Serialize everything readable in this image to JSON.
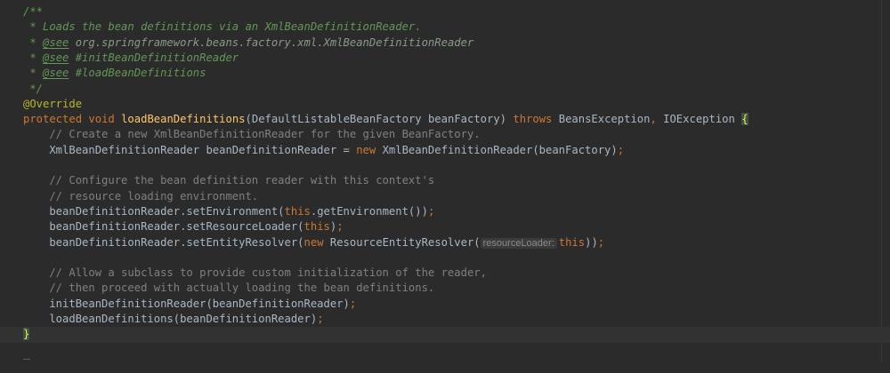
{
  "editor": {
    "lines": {
      "l1": {
        "t1": "/**"
      },
      "l2": {
        "t1": " * Loads the bean definitions via an XmlBeanDefinitionReader."
      },
      "l3": {
        "t1": " * ",
        "t2": "@see",
        "t3": " org.springframework.beans.factory.xml.XmlBeanDefinitionReader"
      },
      "l4": {
        "t1": " * ",
        "t2": "@see",
        "t3": " #initBeanDefinitionReader"
      },
      "l5": {
        "t1": " * ",
        "t2": "@see",
        "t3": " #loadBeanDefinitions"
      },
      "l6": {
        "t1": " */"
      },
      "l7": {
        "t1": "@Override"
      },
      "l8": {
        "t1": "protected",
        "t2": " ",
        "t3": "void",
        "t4": " ",
        "t5": "loadBeanDefinitions",
        "t6": "(DefaultListableBeanFactory beanFactory) ",
        "t7": "throws",
        "t8": " BeansException",
        "t9": ",",
        "t10": " IOException ",
        "t11": "{"
      },
      "l9": {
        "t1": "    // Create a new XmlBeanDefinitionReader for the given BeanFactory."
      },
      "l10": {
        "t1": "    XmlBeanDefinitionReader beanDefinitionReader = ",
        "t2": "new",
        "t3": " XmlBeanDefinitionReader(beanFactory)",
        "t4": ";"
      },
      "l11": {},
      "l12": {
        "t1": "    // Configure the bean definition reader with this context's"
      },
      "l13": {
        "t1": "    // resource loading environment."
      },
      "l14": {
        "t1": "    beanDefinitionReader.setEnvironment(",
        "t2": "this",
        "t3": ".getEnvironment())",
        "t4": ";"
      },
      "l15": {
        "t1": "    beanDefinitionReader.setResourceLoader(",
        "t2": "this",
        "t3": ")",
        "t4": ";"
      },
      "l16": {
        "t1": "    beanDefinitionReader.setEntityResolver(",
        "t2": "new",
        "t3": " ResourceEntityResolver(",
        "hint": "resourceLoader:",
        "t4": "this",
        "t5": "))",
        "t6": ";"
      },
      "l17": {},
      "l18": {
        "t1": "    // Allow a subclass to provide custom initialization of the reader,"
      },
      "l19": {
        "t1": "    // then proceed with actually loading the bean definitions."
      },
      "l20": {
        "t1": "    initBeanDefinitionReader(beanDefinitionReader)",
        "t2": ";"
      },
      "l21": {
        "t1": "    loadBeanDefinitions(beanDefinitionReader)",
        "t2": ";"
      },
      "l22": {
        "t1": "}"
      }
    }
  }
}
